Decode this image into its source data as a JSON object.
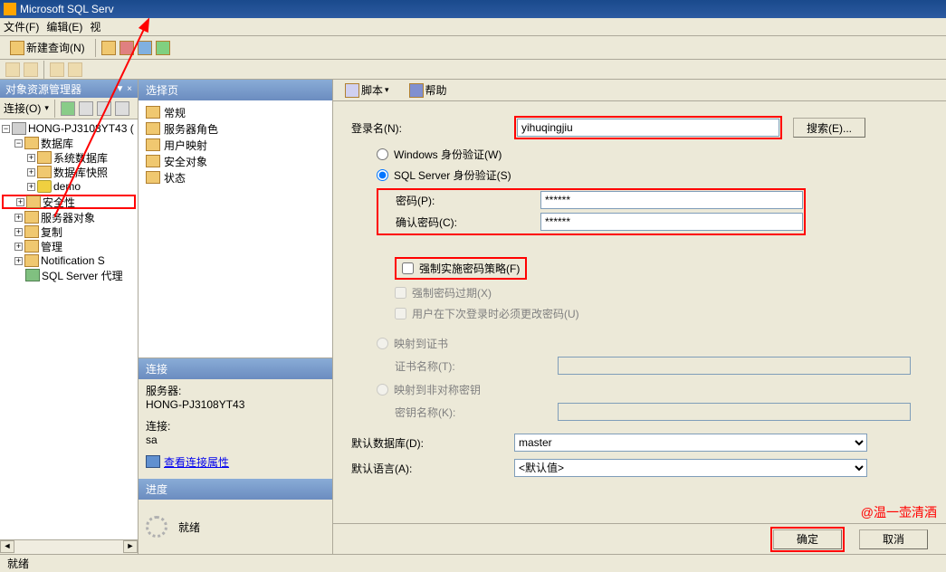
{
  "titlebar": {
    "title": "Microsoft SQL Serv"
  },
  "menubar": {
    "file": "文件(F)",
    "edit": "编辑(E)",
    "view": "视"
  },
  "toolbar": {
    "newquery": "新建查询(N)"
  },
  "object_explorer": {
    "header": "对象资源管理器",
    "connect": "连接(O)",
    "server": "HONG-PJ3108YT43  (",
    "nodes": {
      "db": "数据库",
      "sysdb": "系统数据库",
      "snapshot": "数据库快照",
      "demo": "demo",
      "security": "安全性",
      "serverobj": "服务器对象",
      "replication": "复制",
      "mgmt": "管理",
      "notif": "Notification S",
      "agent": "SQL Server 代理"
    }
  },
  "select_page": {
    "header": "选择页",
    "items": {
      "general": "常规",
      "roles": "服务器角色",
      "mapping": "用户映射",
      "securables": "安全对象",
      "status": "状态"
    }
  },
  "connection": {
    "header": "连接",
    "server_lbl": "服务器:",
    "server_val": "HONG-PJ3108YT43",
    "conn_lbl": "连接:",
    "conn_val": "sa",
    "view_props": "查看连接属性"
  },
  "progress": {
    "header": "进度",
    "status": "就绪"
  },
  "right_toolbar": {
    "script": "脚本",
    "help": "帮助"
  },
  "form": {
    "login_lbl": "登录名(N):",
    "login_val": "yihuqingjiu",
    "search_btn": "搜索(E)...",
    "auth_win": "Windows 身份验证(W)",
    "auth_sql": "SQL Server 身份验证(S)",
    "pw_lbl": "密码(P):",
    "pw_val": "******",
    "pwc_lbl": "确认密码(C):",
    "pwc_val": "******",
    "enforce_policy": "强制实施密码策略(F)",
    "enforce_expire": "强制密码过期(X)",
    "must_change": "用户在下次登录时必须更改密码(U)",
    "map_cert": "映射到证书",
    "cert_lbl": "证书名称(T):",
    "map_key": "映射到非对称密钥",
    "key_lbl": "密钥名称(K):",
    "defdb_lbl": "默认数据库(D):",
    "defdb_val": "master",
    "deflang_lbl": "默认语言(A):",
    "deflang_val": "<默认值>"
  },
  "footer": {
    "ok": "确定",
    "cancel": "取消"
  },
  "statusbar": {
    "text": "就绪"
  },
  "watermark": "@温一壶清酒"
}
